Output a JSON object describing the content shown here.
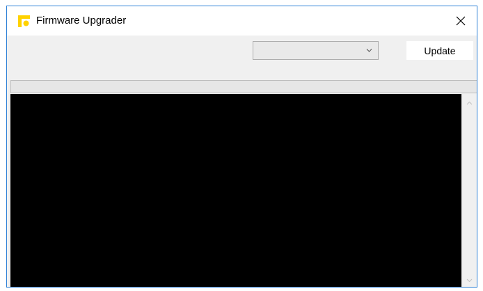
{
  "window": {
    "title": "Firmware Upgrader",
    "icon": "app-logo-icon",
    "brand_color": "#ffd200"
  },
  "toolbar": {
    "device_select": {
      "selected": ""
    },
    "update_label": "Update"
  },
  "progress": {
    "value": 0
  },
  "console": {
    "text": ""
  },
  "colors": {
    "window_border": "#2b7fd6",
    "console_background": "#000000",
    "chrome_background": "#f0f0f0"
  }
}
